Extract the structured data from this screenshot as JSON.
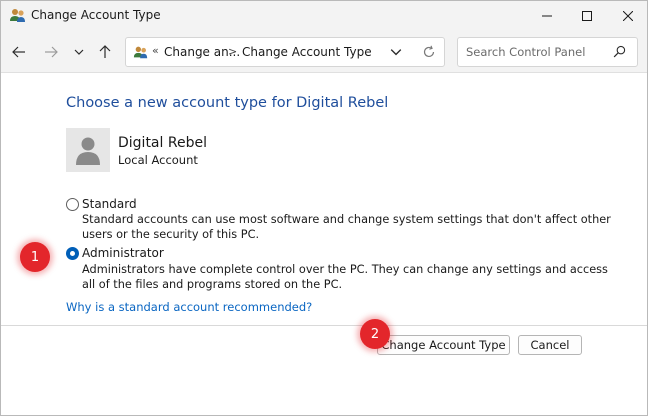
{
  "window": {
    "title": "Change Account Type"
  },
  "navigation": {
    "breadcrumb_overflow": "«",
    "breadcrumb_parent": "Change an...",
    "breadcrumb_separator": ">",
    "breadcrumb_current": "Change Account Type"
  },
  "search": {
    "placeholder": "Search Control Panel"
  },
  "content": {
    "heading": "Choose a new account type for Digital Rebel",
    "user_name": "Digital Rebel",
    "user_account_type": "Local Account",
    "options": [
      {
        "label": "Standard",
        "description": "Standard accounts can use most software and change system settings that don't affect other users or the security of this PC.",
        "selected": false
      },
      {
        "label": "Administrator",
        "description": "Administrators have complete control over the PC. They can change any settings and access all of the files and programs stored on the PC.",
        "selected": true
      }
    ],
    "help_link": "Why is a standard account recommended?"
  },
  "buttons": {
    "change_label": "Change Account Type",
    "cancel_label": "Cancel"
  },
  "annotations": {
    "marker_1": "1",
    "marker_2": "2"
  },
  "colors": {
    "accent": "#005fb8",
    "heading": "#1f4e9c",
    "link": "#0a66c2",
    "marker": "#e3262b"
  }
}
